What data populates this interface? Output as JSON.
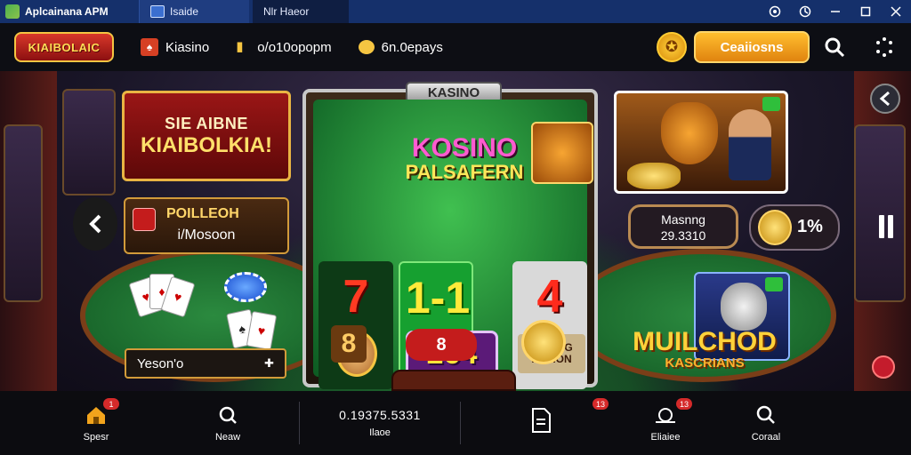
{
  "titlebar": {
    "app_name": "Aplcainana APM",
    "tabs": [
      {
        "label": "Isaide"
      },
      {
        "label": "Nlr Haeor"
      }
    ],
    "controls": [
      "target-icon",
      "settings-icon",
      "minimize-icon",
      "maximize-icon",
      "close-icon"
    ]
  },
  "topbar": {
    "logo_text": "KIAIBOLAIC",
    "items": [
      {
        "label": "Kiasino"
      },
      {
        "label": "o/o10opopm"
      },
      {
        "label": "6n.0epays"
      }
    ],
    "cta_label": "Ceaiiosns",
    "colors": {
      "accent": "#f2a41c",
      "bar": "#0d0e14"
    }
  },
  "left_panel": {
    "banner_line1": "SIE AIBNE",
    "banner_line2": "KIAIBOLKIA!",
    "promo_title": "POILLEOH",
    "promo_sub": "i/Mosoon",
    "select_value": "Yeson'o"
  },
  "slot": {
    "badge": "KASINO",
    "title": "KOSINO",
    "subtitle": "PALSAFERN",
    "reel_symbols": [
      "7",
      "1-1",
      "4"
    ],
    "plate_value": "264",
    "rune_text": "DUNING MAHON",
    "tile_value": "8",
    "dice_text": "8",
    "colors": {
      "felt": "#1f8a35",
      "frame": "#c8c8c8"
    }
  },
  "right_panel": {
    "stat_label": "Masnng",
    "stat_value": "29.3310",
    "percent": "1%",
    "multi_title": "MUILCHOD",
    "multi_sub": "KASCRIANS"
  },
  "bottombar": {
    "items": [
      {
        "label": "Spesr",
        "icon": "home-icon",
        "badge": "1"
      },
      {
        "label": "Neaw",
        "icon": "search-icon"
      },
      {
        "label": "Ilaoe",
        "value": "0.19375.5331"
      },
      {
        "label": "",
        "icon": "document-icon",
        "badge": "13"
      },
      {
        "label": "Eliaiee",
        "icon": "snail-icon",
        "badge": "13"
      },
      {
        "label": "Coraal",
        "icon": "magnifier-icon"
      }
    ]
  }
}
